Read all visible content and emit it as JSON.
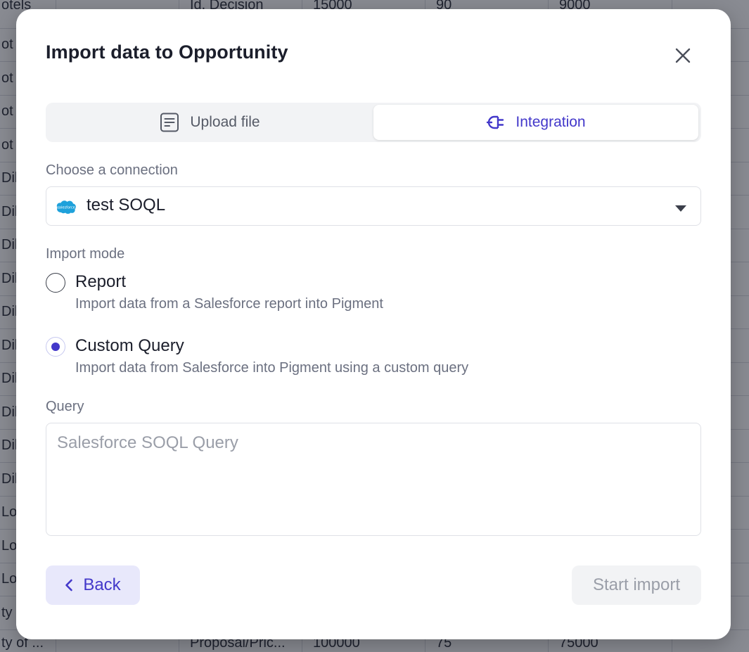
{
  "background": {
    "rows": [
      {
        "c0": "otels",
        "c3": "Id. Decision",
        "c4": "15000",
        "c5": "90",
        "c6": "9000"
      },
      {
        "c0": "ot"
      },
      {
        "c0": "ot"
      },
      {
        "c0": "ot"
      },
      {
        "c0": "ot"
      },
      {
        "c0": "Dil"
      },
      {
        "c0": "Dil"
      },
      {
        "c0": "Dil"
      },
      {
        "c0": "Dil"
      },
      {
        "c0": "Dil"
      },
      {
        "c0": "Dil"
      },
      {
        "c0": "Dil"
      },
      {
        "c0": "Dil"
      },
      {
        "c0": "Dil"
      },
      {
        "c0": "Dil"
      },
      {
        "c0": "Lo"
      },
      {
        "c0": "Lo"
      },
      {
        "c0": "Lo"
      },
      {
        "c0": "ty"
      },
      {
        "c0": "ty of ...",
        "c3": "Proposal/Pric...",
        "c4": "100000",
        "c5": "75",
        "c6": "75000"
      }
    ]
  },
  "modal": {
    "title": "Import data to Opportunity",
    "tabs": [
      {
        "label": "Upload file",
        "icon": "document-icon",
        "active": false
      },
      {
        "label": "Integration",
        "icon": "plug-icon",
        "active": true
      }
    ],
    "connection": {
      "label": "Choose a connection",
      "value": "test SOQL",
      "logo": "salesforce-logo"
    },
    "import_mode": {
      "label": "Import mode",
      "options": [
        {
          "title": "Report",
          "description": "Import data from a Salesforce report into Pigment",
          "selected": false
        },
        {
          "title": "Custom Query",
          "description": "Import data from Salesforce into Pigment using a custom query",
          "selected": true
        }
      ]
    },
    "query": {
      "label": "Query",
      "value": "",
      "placeholder": "Salesforce SOQL Query"
    },
    "back_label": "Back",
    "start_label": "Start import",
    "colors": {
      "accent": "#4338ca",
      "back_bg": "#e8e8fb",
      "disabled_bg": "#f2f3f5"
    }
  }
}
